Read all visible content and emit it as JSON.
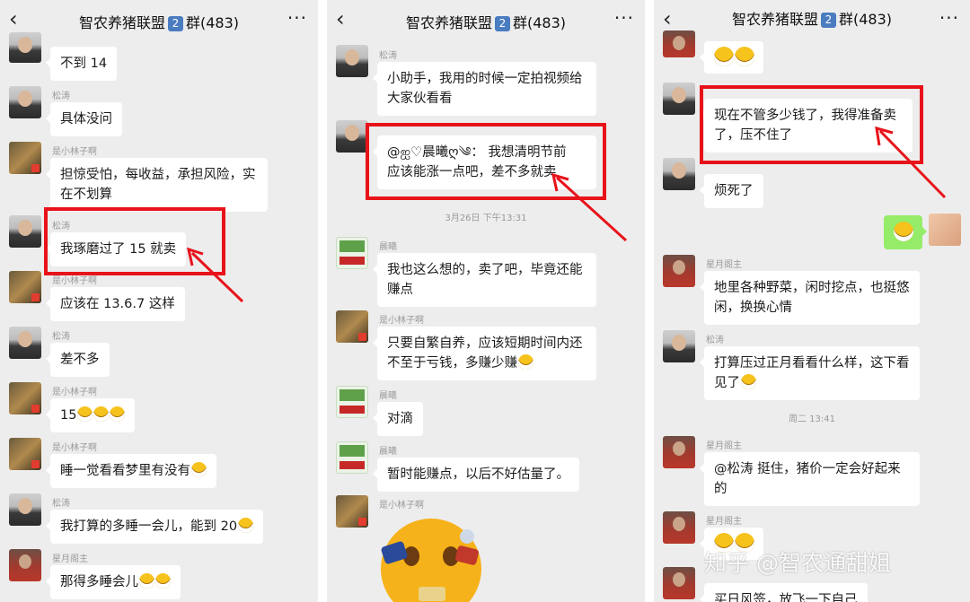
{
  "header": {
    "title_prefix": "智农养猪联盟",
    "title_badge": "2",
    "title_suffix": "群(483)",
    "back_icon": "‹",
    "more_icon": "···"
  },
  "panel1": {
    "nick_song": "松涛",
    "nick_lin": "是小林子啊",
    "nick_xing": "星月阁主",
    "m1": "不到 14",
    "m2": "具体没问",
    "m3": "担惊受怕，每收益，承担风险，实在不划算",
    "m4": "我琢磨过了 15 就卖",
    "m5": "应该在 13.6.7 这样",
    "m6": "差不多",
    "m7": "15",
    "m8": "睡一觉看看梦里有没有",
    "m9": "我打算的多睡一会儿，能到 20",
    "m10": "那得多睡会儿"
  },
  "panel2": {
    "nick_song": "松涛",
    "nick_chen": "晨曦",
    "nick_lin": "是小林子啊",
    "m1": "小助手，我用的时候一定拍视频给大家伙看看",
    "m2_line1": "@ஐ♡晨曦ღ༄：  我想清明节前",
    "m2_line2": "应该能涨一点吧，差不多就卖",
    "time1": "3月26日 下午13:31",
    "m3": "我也这么想的，卖了吧，毕竟还能赚点",
    "m4": "只要自繁自养，应该短期时间内还不至于亏钱，多赚少赚",
    "m5": "对滴",
    "m6": "暂时能赚点，以后不好估量了。"
  },
  "panel3": {
    "nick_song": "松涛",
    "nick_xing": "星月阁主",
    "m1": "现在不管多少钱了，我得准备卖了，压不住了",
    "m2": "烦死了",
    "m3": "地里各种野菜，闲时挖点，也挺悠闲，换换心情",
    "m4": "打算压过正月看看什么样，这下看见了",
    "time1": "周二 13:41",
    "m5": "@松涛  挺住，猪价一定会好起来的",
    "m6_partial": "买日风签，放飞一下自己"
  },
  "watermark": "知乎 @智农通甜姐",
  "colors": {
    "highlight": "#e8121a",
    "self_bubble": "#95ec69",
    "chat_bg": "#ededed"
  },
  "icons": {
    "back": "back-chevron-icon",
    "more": "more-dots-icon",
    "emoji": "grin-emoji-icon"
  }
}
